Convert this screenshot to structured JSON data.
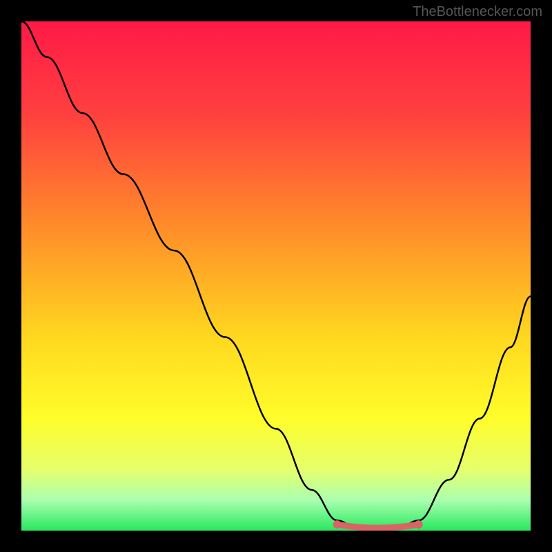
{
  "watermark": "TheBottlenecker.com",
  "chart_data": {
    "type": "line",
    "title": "",
    "xlabel": "",
    "ylabel": "",
    "xlim": [
      0,
      100
    ],
    "ylim": [
      0,
      100
    ],
    "background_gradient": {
      "stops": [
        {
          "offset": 0,
          "color": "#ff1a47"
        },
        {
          "offset": 18,
          "color": "#ff3f3f"
        },
        {
          "offset": 40,
          "color": "#ff8b2a"
        },
        {
          "offset": 62,
          "color": "#ffd81f"
        },
        {
          "offset": 78,
          "color": "#fffd2a"
        },
        {
          "offset": 88,
          "color": "#e6ff6c"
        },
        {
          "offset": 94,
          "color": "#aaffb0"
        },
        {
          "offset": 100,
          "color": "#28e85e"
        }
      ]
    },
    "series": [
      {
        "name": "bottleneck-curve",
        "color": "#000000",
        "points": [
          {
            "x": 0,
            "y": 100
          },
          {
            "x": 5,
            "y": 93
          },
          {
            "x": 12,
            "y": 82
          },
          {
            "x": 20,
            "y": 70
          },
          {
            "x": 30,
            "y": 55
          },
          {
            "x": 40,
            "y": 38
          },
          {
            "x": 50,
            "y": 20
          },
          {
            "x": 57,
            "y": 8
          },
          {
            "x": 62,
            "y": 2
          },
          {
            "x": 66,
            "y": 0.5
          },
          {
            "x": 70,
            "y": 0.2
          },
          {
            "x": 74,
            "y": 0.5
          },
          {
            "x": 78,
            "y": 2
          },
          {
            "x": 84,
            "y": 10
          },
          {
            "x": 90,
            "y": 22
          },
          {
            "x": 96,
            "y": 36
          },
          {
            "x": 100,
            "y": 46
          }
        ]
      }
    ],
    "highlight_segment": {
      "color": "#d96464",
      "start_x": 62,
      "end_x": 78,
      "y": 0.8,
      "endpoint_radius": 1.2
    }
  }
}
